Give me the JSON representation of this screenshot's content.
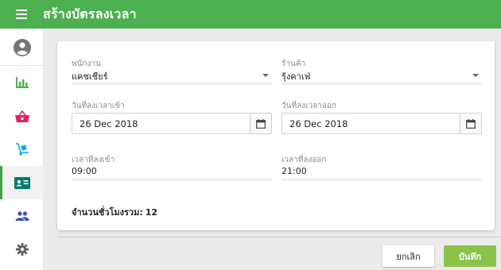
{
  "header": {
    "title": "สร้างบัตรลงเวลา",
    "menu_icon": "hamburger-icon",
    "color": "#4caf50"
  },
  "sidebar": {
    "items": [
      {
        "icon": "account-circle-icon",
        "active": false
      },
      {
        "icon": "bar-chart-icon",
        "active": false
      },
      {
        "icon": "shopping-basket-icon",
        "active": false
      },
      {
        "icon": "hand-truck-icon",
        "active": false
      },
      {
        "icon": "id-card-icon",
        "active": true
      },
      {
        "icon": "people-icon",
        "active": false
      },
      {
        "icon": "settings-icon",
        "active": false
      }
    ],
    "active_color": "#43a047"
  },
  "form": {
    "employee": {
      "label": "พนักงาน",
      "value": "แคชเชียร์"
    },
    "store": {
      "label": "ร้านค้า",
      "value": "รุ้งคาเฟ่"
    },
    "date_in": {
      "label": "วันที่ลงเวลาเข้า",
      "value": "26 Dec 2018"
    },
    "date_out": {
      "label": "วันที่ลงเวลาออก",
      "value": "26 Dec 2018"
    },
    "time_in": {
      "label": "เวลาที่ลงเข้า",
      "value": "09:00"
    },
    "time_out": {
      "label": "เวลาที่ลงออก",
      "value": "21:00"
    },
    "total_hours": {
      "label": "จำนวนชั่วโมงรวม:",
      "value": "12"
    }
  },
  "buttons": {
    "cancel": "ยกเลิก",
    "save": "บันทึก",
    "save_color": "#8bc34a"
  }
}
